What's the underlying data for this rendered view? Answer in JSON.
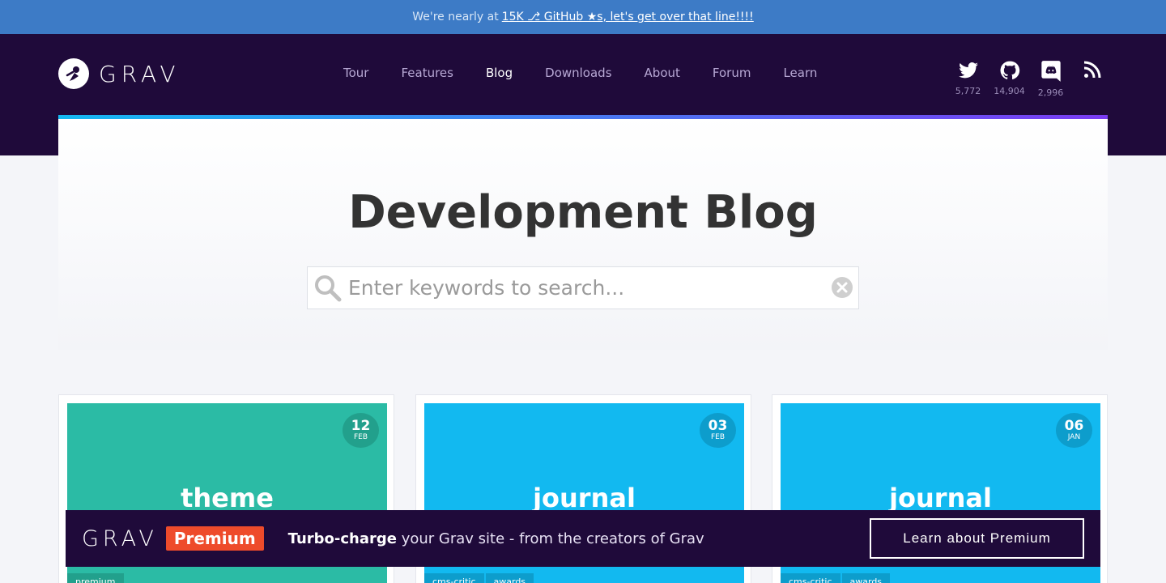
{
  "announcement": {
    "prefix": "We're nearly at",
    "link_text": "15K ⎇ GitHub ★s, let's get over that line!!!!"
  },
  "brand": {
    "name": "GRAV"
  },
  "nav": {
    "items": [
      {
        "label": "Tour"
      },
      {
        "label": "Features"
      },
      {
        "label": "Blog"
      },
      {
        "label": "Downloads"
      },
      {
        "label": "About"
      },
      {
        "label": "Forum"
      },
      {
        "label": "Learn"
      }
    ],
    "active": "Blog"
  },
  "social": [
    {
      "icon": "twitter-icon",
      "count": "5,772"
    },
    {
      "icon": "github-icon",
      "count": "14,904"
    },
    {
      "icon": "discord-icon",
      "count": "2,996"
    },
    {
      "icon": "rss-icon",
      "count": ""
    }
  ],
  "hero": {
    "title": "Development Blog",
    "search_placeholder": "Enter keywords to search..."
  },
  "cards": [
    {
      "day": "12",
      "month": "FEB",
      "category": "theme",
      "tags": [
        "premium"
      ],
      "color": "#2bbba5",
      "date_color": "#22a08c"
    },
    {
      "day": "03",
      "month": "FEB",
      "category": "journal",
      "tags": [
        "cms-critic",
        "awards"
      ],
      "color": "#12b9f0",
      "date_color": "#0d9dcc"
    },
    {
      "day": "06",
      "month": "JAN",
      "category": "journal",
      "tags": [
        "cms-critic",
        "awards"
      ],
      "color": "#12b9f0",
      "date_color": "#0d9dcc"
    }
  ],
  "promo": {
    "logo": "GRAV",
    "badge": "Premium",
    "bold": "Turbo-charge",
    "rest": " your Grav site - from the creators of Grav",
    "button": "Learn about Premium"
  }
}
